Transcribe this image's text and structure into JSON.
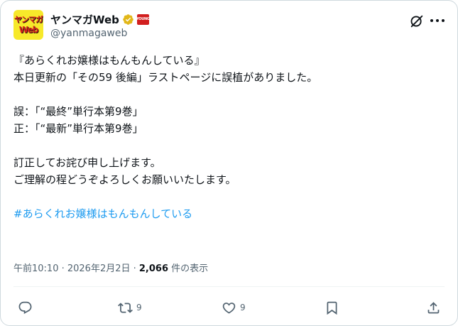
{
  "author": {
    "avatar_top": "ヤンマガ",
    "avatar_bottom": "Web",
    "display_name": "ヤンマガWeb",
    "org_badge": "YOUNG",
    "handle": "@yanmagaweb"
  },
  "tweet": {
    "lines": [
      "『あらくれお嬢様はもんもんしている』",
      "本日更新の「その59 後編」ラストページに誤植がありました。",
      "",
      "誤：「“最終”単行本第9巻」",
      "正：「“最新”単行本第9巻」",
      "",
      "訂正してお詫び申し上げます。",
      "ご理解の程どうぞよろしくお願いいたします。",
      ""
    ],
    "hashtag": "#あらくれお嬢様はもんもんしている"
  },
  "meta": {
    "timestamp": "午前10:10 · 2026年2月2日 · ",
    "views_count": "2,066",
    "views_label": " 件の表示"
  },
  "actions": {
    "reply_count": "",
    "retweet_count": "9",
    "like_count": "9"
  },
  "icons": {
    "header": [
      "grok-icon",
      "more-icon"
    ],
    "actions": [
      "reply-icon",
      "retweet-icon",
      "like-icon",
      "bookmark-icon",
      "share-icon"
    ]
  },
  "colors": {
    "text": "#0f1419",
    "muted": "#536471",
    "link": "#1d9bf0",
    "verified_gold": "#e2b719",
    "avatar_bg": "#f7e92a"
  }
}
